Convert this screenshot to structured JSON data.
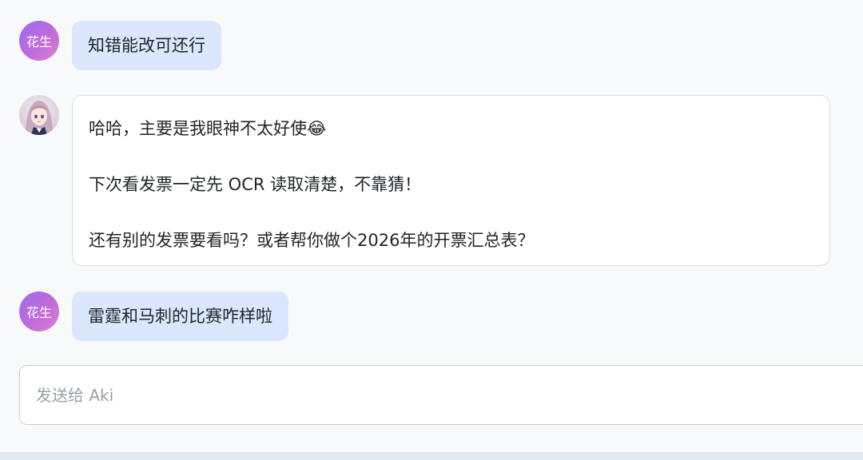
{
  "messages": [
    {
      "role": "user",
      "avatar_text": "花生",
      "text": "知错能改可还行"
    },
    {
      "role": "assistant",
      "avatar": "anime-girl-avatar",
      "paragraphs": [
        "哈哈，主要是我眼神不太好使😂",
        "下次看发票一定先 OCR 读取清楚，不靠猜！",
        "还有别的发票要看吗？或者帮你做个2026年的开票汇总表？"
      ]
    },
    {
      "role": "user",
      "avatar_text": "花生",
      "text": "雷霆和马刺的比赛咋样啦"
    }
  ],
  "composer": {
    "placeholder": "发送给 Aki",
    "value": ""
  },
  "colors": {
    "user_bubble": "#dbe7fd",
    "bot_bubble": "#ffffff",
    "avatar_gradient_start": "#9b6cf0",
    "avatar_gradient_end": "#d98ad6"
  }
}
